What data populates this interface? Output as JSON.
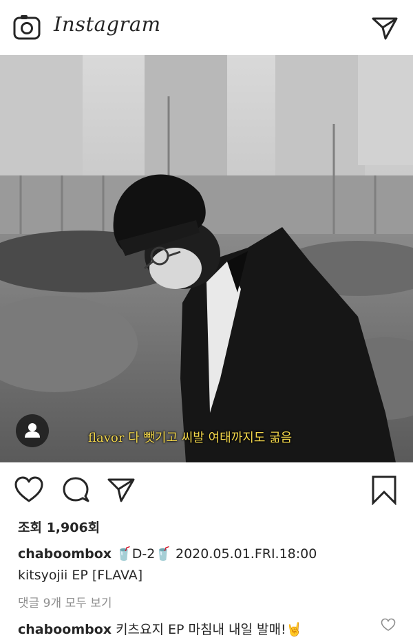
{
  "app": {
    "logo_text": "Instagram",
    "icons": {
      "camera": "camera-icon",
      "direct": "direct-message-icon"
    }
  },
  "post": {
    "subtitle": "flavor 다 뺏기고 씨발 여태까지도 굶음",
    "views": "조회 1,906회",
    "caption": {
      "username": "chaboombox",
      "line1": " 🥤D-2🥤 2020.05.01.FRI.18:00",
      "line2": "kitsyojii EP [FLAVA]"
    },
    "view_all_comments": "댓글 9개 모두 보기",
    "comment": {
      "username": "chaboombox",
      "text": " 키츠요지 EP 마침내 내일 발매!🤘"
    },
    "action_icons": [
      "heart-icon",
      "comment-icon",
      "share-icon",
      "bookmark-icon"
    ]
  }
}
